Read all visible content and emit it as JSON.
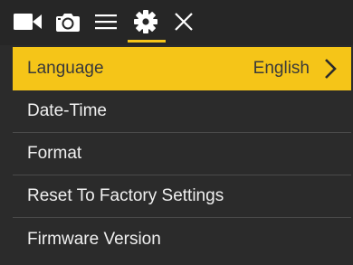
{
  "toolbar": {
    "tabs": [
      {
        "icon": "video-camera-icon"
      },
      {
        "icon": "photo-camera-icon"
      },
      {
        "icon": "menu-lines-icon"
      },
      {
        "icon": "gear-icon",
        "active": true
      },
      {
        "icon": "close-icon"
      }
    ]
  },
  "menu": {
    "items": [
      {
        "label": "Language",
        "value": "English",
        "selected": true
      },
      {
        "label": "Date-Time"
      },
      {
        "label": "Format"
      },
      {
        "label": "Reset To Factory Settings"
      },
      {
        "label": "Firmware Version"
      }
    ]
  },
  "colors": {
    "accent": "#f5c518",
    "background": "#2b2b2b",
    "toolbar": "#262626",
    "text": "#f0f0f0"
  }
}
